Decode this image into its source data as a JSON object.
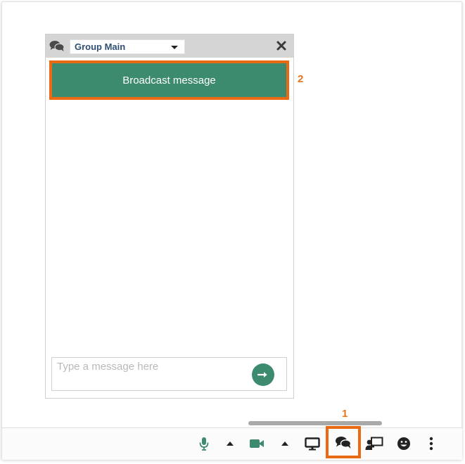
{
  "chat": {
    "group_select": {
      "selected": "Group Main"
    },
    "broadcast_label": "Broadcast message",
    "input_placeholder": "Type a message here"
  },
  "annotations": {
    "label_1": "1",
    "label_2": "2"
  },
  "toolbar": {
    "items": [
      {
        "name": "microphone-icon",
        "color": "#3d8b6e"
      },
      {
        "name": "audio-options-caret-icon",
        "color": "#222222"
      },
      {
        "name": "video-camera-icon",
        "color": "#3d8b6e"
      },
      {
        "name": "video-options-caret-icon",
        "color": "#222222"
      },
      {
        "name": "screen-share-icon",
        "color": "#222222"
      },
      {
        "name": "chat-icon",
        "color": "#222222"
      },
      {
        "name": "presenter-icon",
        "color": "#222222"
      },
      {
        "name": "emoji-icon",
        "color": "#222222"
      },
      {
        "name": "more-options-icon",
        "color": "#222222"
      }
    ]
  },
  "colors": {
    "accent_green": "#3d8b6e",
    "highlight_orange": "#ea6a14",
    "header_gray": "#d5d5d5"
  }
}
